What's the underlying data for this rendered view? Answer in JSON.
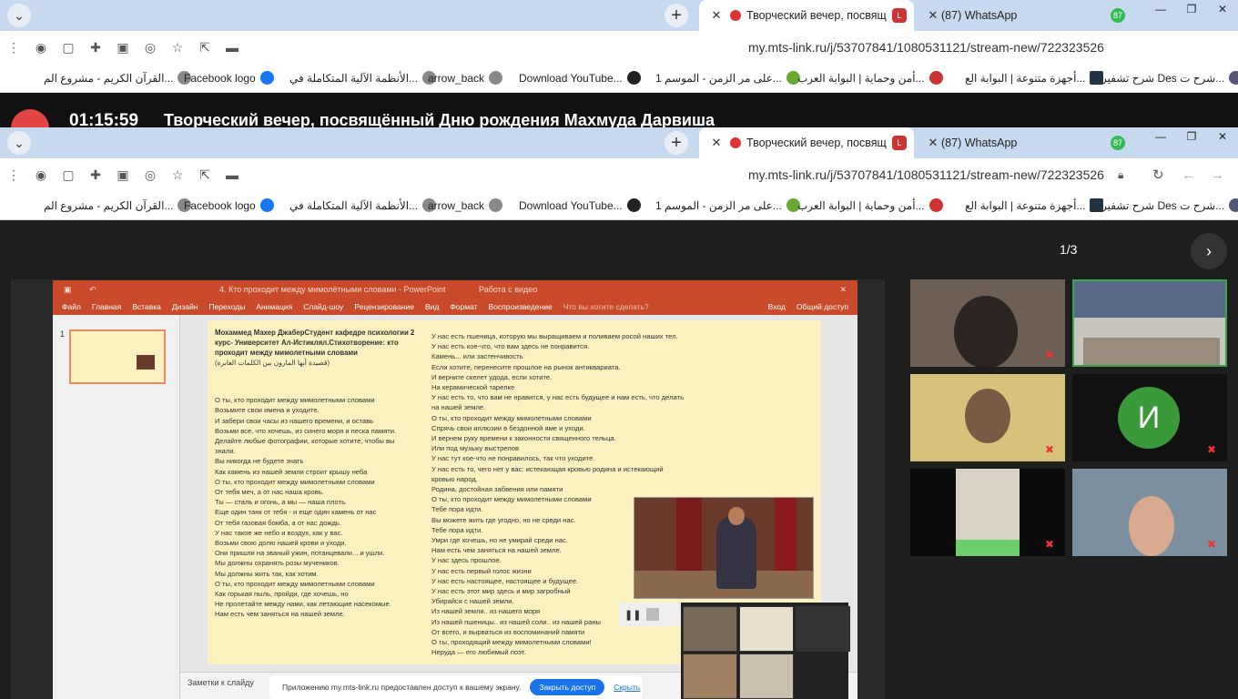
{
  "browser": {
    "tabs": [
      {
        "title": "Творческий вечер, посвящ",
        "active": true
      },
      {
        "title": "(87) WhatsApp",
        "active": false,
        "badge": "87"
      }
    ],
    "url": "my.mts-link.ru/j/53707841/1080531121/stream-new/722323526",
    "bookmarks": [
      "القرآن الكريم - مشروع الم...",
      "Facebook logo",
      "الأنظمة الآلية المتكاملة في...",
      "arrow_back",
      "Download YouTube...",
      "على مر الزمن - الموسم 1...",
      "أمن وحماية | البوابة العرب...",
      "أجهزة متنوعة | البوابة الع...",
      "شرح تشفير Des شرح ت..."
    ],
    "icons": {
      "menu": "chevron-down-icon",
      "new_tab": "plus-icon",
      "close": "close-icon"
    }
  },
  "meeting": {
    "timer": "01:15:59",
    "event_title": "Творческий вечер, посвящённый Дню рождения Махмуда Дарвиша",
    "pager": "1/3"
  },
  "powerpoint": {
    "window_title": "4. Кто проходит между мимолётными словами - PowerPoint",
    "video_tools": "Работа с видео",
    "menu": [
      "Файл",
      "Главная",
      "Вставка",
      "Дизайн",
      "Переходы",
      "Анимация",
      "Слайд-шоу",
      "Рецензирование",
      "Вид",
      "Формат",
      "Воспроизведение",
      "Что вы хотите сделать?",
      "Вход",
      "Общий доступ"
    ],
    "slide_number": "1",
    "notes_label": "Заметки к слайду"
  },
  "slide": {
    "header_lines": [
      "Мохаммед Махер ДжаберСтудент кафедре психологии  2",
      "курс- Университет Ал-Истиклял.Стихотворение:  кто",
      "проходит между мимолетными словами",
      "(قصيدة أيها المارون بين الكلمات العابرة)"
    ],
    "col_a": [
      "О ты, кто проходит между мимолетными словами",
      "Возьмите свои имена и уходите.",
      "И забери свои часы из нашего времени, и оставь",
      "Возьми все, что хочешь, из синего моря и песка памяти.",
      "Делайте любые фотографии, которые хотите, чтобы вы",
      "знали.",
      "Вы никогда не будете знать",
      "Как камень из нашей земли строит крышу неба",
      "О ты, кто проходит между мимолетными словами",
      "От тебя меч, а от нас наша кровь.",
      "Ты — сталь и огонь, а мы — наша плоть.",
      "Еще один танк от тебя - и еще один камень от нас",
      "От тебя газовая бомба, а от нас дождь.",
      "У нас такое же небо и воздух, как у вас.",
      "Возьми свою долю нашей крови и уходи.",
      "Они пришли на званый ужин, потанцевали... и ушли.",
      "Мы должны охранять розы мучеников.",
      "Мы должны жить так, как хотим.",
      "О ты, кто проходит между мимолетными словами",
      "Как горькая пыль, пройди, где хочешь, но",
      "Не пролетайте между нами, как летающие насекомые.",
      "Нам есть чем заняться на нашей земле."
    ],
    "col_b": [
      "У нас есть пшеница, которую мы выращиваем и поливаем росой наших тел.",
      "У нас есть кое-что, что вам здесь не понравится.",
      "Камень... или застенчивость",
      "Если хотите, перенесите прошлое на рынок антиквариата.",
      "И верните скелет удода, если хотите.",
      "На керамической тарелке",
      "У нас есть то, что вам не нравится, у нас есть будущее и нам есть, что делать",
      "на нашей земле.",
      "О ты, кто проходит между мимолетными словами",
      "Спрячь свои иллюзии в бездонной яме и уходи.",
      "И вернем руку времени к законности священного тельца.",
      "Или под музыку выстрелов",
      "У нас тут кое-что не понравилось, так что уходите.",
      "У нас есть то, чего нет у вас: истекающая кровью родина и истекающий",
      "кровью народ.",
      "Родина, достойная забвения или памяти",
      "О ты, кто проходит между мимолетными словами",
      "Тебе пора идти.",
      "Вы можете жить где угодно, но не среди нас.",
      "Тебе пора идти.",
      "Умри где хочешь, но не умирай среди нас.",
      "Нам есть чем заняться на нашей земле.",
      "У нас здесь прошлое.",
      "У нас есть первый голос жизни",
      "У нас есть настоящее, настоящее и будущее.",
      "У нас есть этот мир здесь и мир загробный",
      "Убирайся с нашей земли.",
      "Из нашей земли.. из нашего моря",
      "Из нашей пшеницы.. из нашей соли.. из нашей раны",
      "От всего, и вырваться из воспоминаний памяти",
      "О ты, проходящий между мимолетными словами!",
      "Неруда — его любимый поэт."
    ]
  },
  "share_banner": {
    "text": "Приложению my.mts-link.ru предоставлен доступ к вашему экрану.",
    "stop": "Закрыть доступ",
    "hide": "Скрыть"
  },
  "participants": [
    {
      "initial": "",
      "muted": true
    },
    {
      "initial": "",
      "muted": false
    },
    {
      "initial": "",
      "muted": true
    },
    {
      "initial": "И",
      "muted": true
    },
    {
      "initial": "",
      "muted": true
    },
    {
      "initial": "",
      "muted": true
    }
  ],
  "colors": {
    "ppt_red": "#c84a2a",
    "slide_bg": "#fbf1c0",
    "active_speaker": "#3ca34a",
    "avatar_green": "#3a9a3a"
  }
}
